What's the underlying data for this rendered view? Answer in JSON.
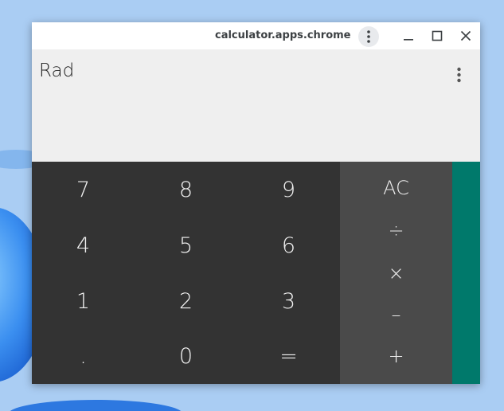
{
  "window": {
    "title": "calculator.apps.chrome"
  },
  "display": {
    "angle_mode": "Rad",
    "expression": ""
  },
  "keypad": {
    "rows": [
      [
        "7",
        "8",
        "9"
      ],
      [
        "4",
        "5",
        "6"
      ],
      [
        "1",
        "2",
        "3"
      ],
      [
        ".",
        "0",
        "="
      ]
    ]
  },
  "operators": {
    "clear": "AC",
    "divide": "÷",
    "multiply": "×",
    "subtract": "–",
    "add": "+"
  },
  "colors": {
    "numpad_bg": "#333333",
    "operator_bg": "#4a4a4a",
    "accent_drawer": "#00796b",
    "display_bg": "#efefef"
  },
  "icons": {
    "title_menu": "more-vert-icon",
    "minimize": "minimize-icon",
    "maximize": "maximize-icon",
    "close": "close-icon",
    "display_menu": "more-vert-icon"
  }
}
